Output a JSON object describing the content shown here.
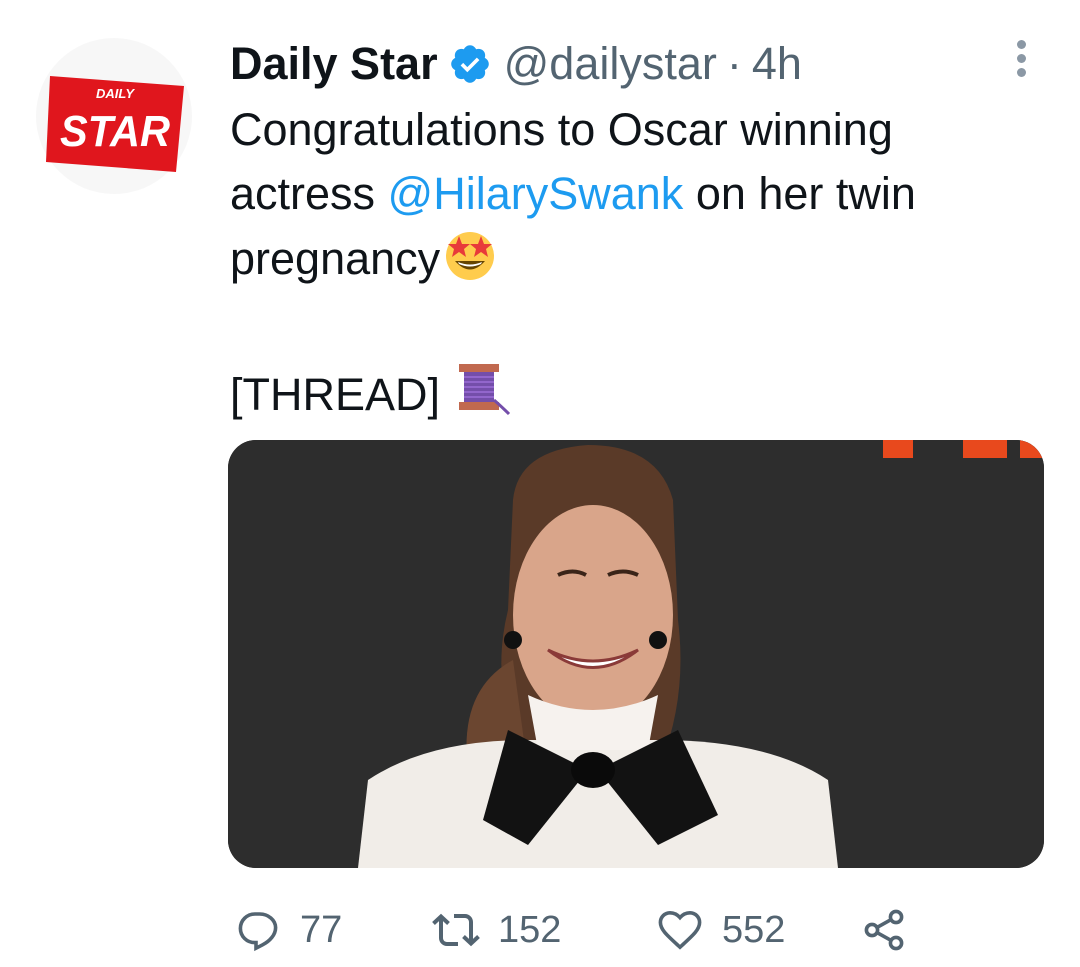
{
  "author": {
    "name": "Daily Star",
    "handle": "@dailystar",
    "separator": "·",
    "time": "4h",
    "logo_small_text": "DAILY",
    "logo_big_text": "STAR",
    "logo_color": "#e0161d"
  },
  "tweet": {
    "text_part1": "Congratulations to Oscar winning actress ",
    "mention": "@HilarySwank",
    "text_part2": " on her twin pregnancy",
    "emoji_after_text": "star-struck-emoji",
    "thread_label": "[THREAD]",
    "emoji_after_thread": "spool-of-thread-emoji"
  },
  "media": {
    "icon": "photo-woman-smiling-bow-tie"
  },
  "actions": {
    "replies": "77",
    "retweets": "152",
    "likes": "552",
    "reply_icon": "reply-icon",
    "retweet_icon": "retweet-icon",
    "like_icon": "heart-icon",
    "share_icon": "share-icon"
  },
  "colors": {
    "text": "#0f1419",
    "secondary": "#536471",
    "link": "#1d9bf0",
    "verified": "#1d9bf0"
  }
}
